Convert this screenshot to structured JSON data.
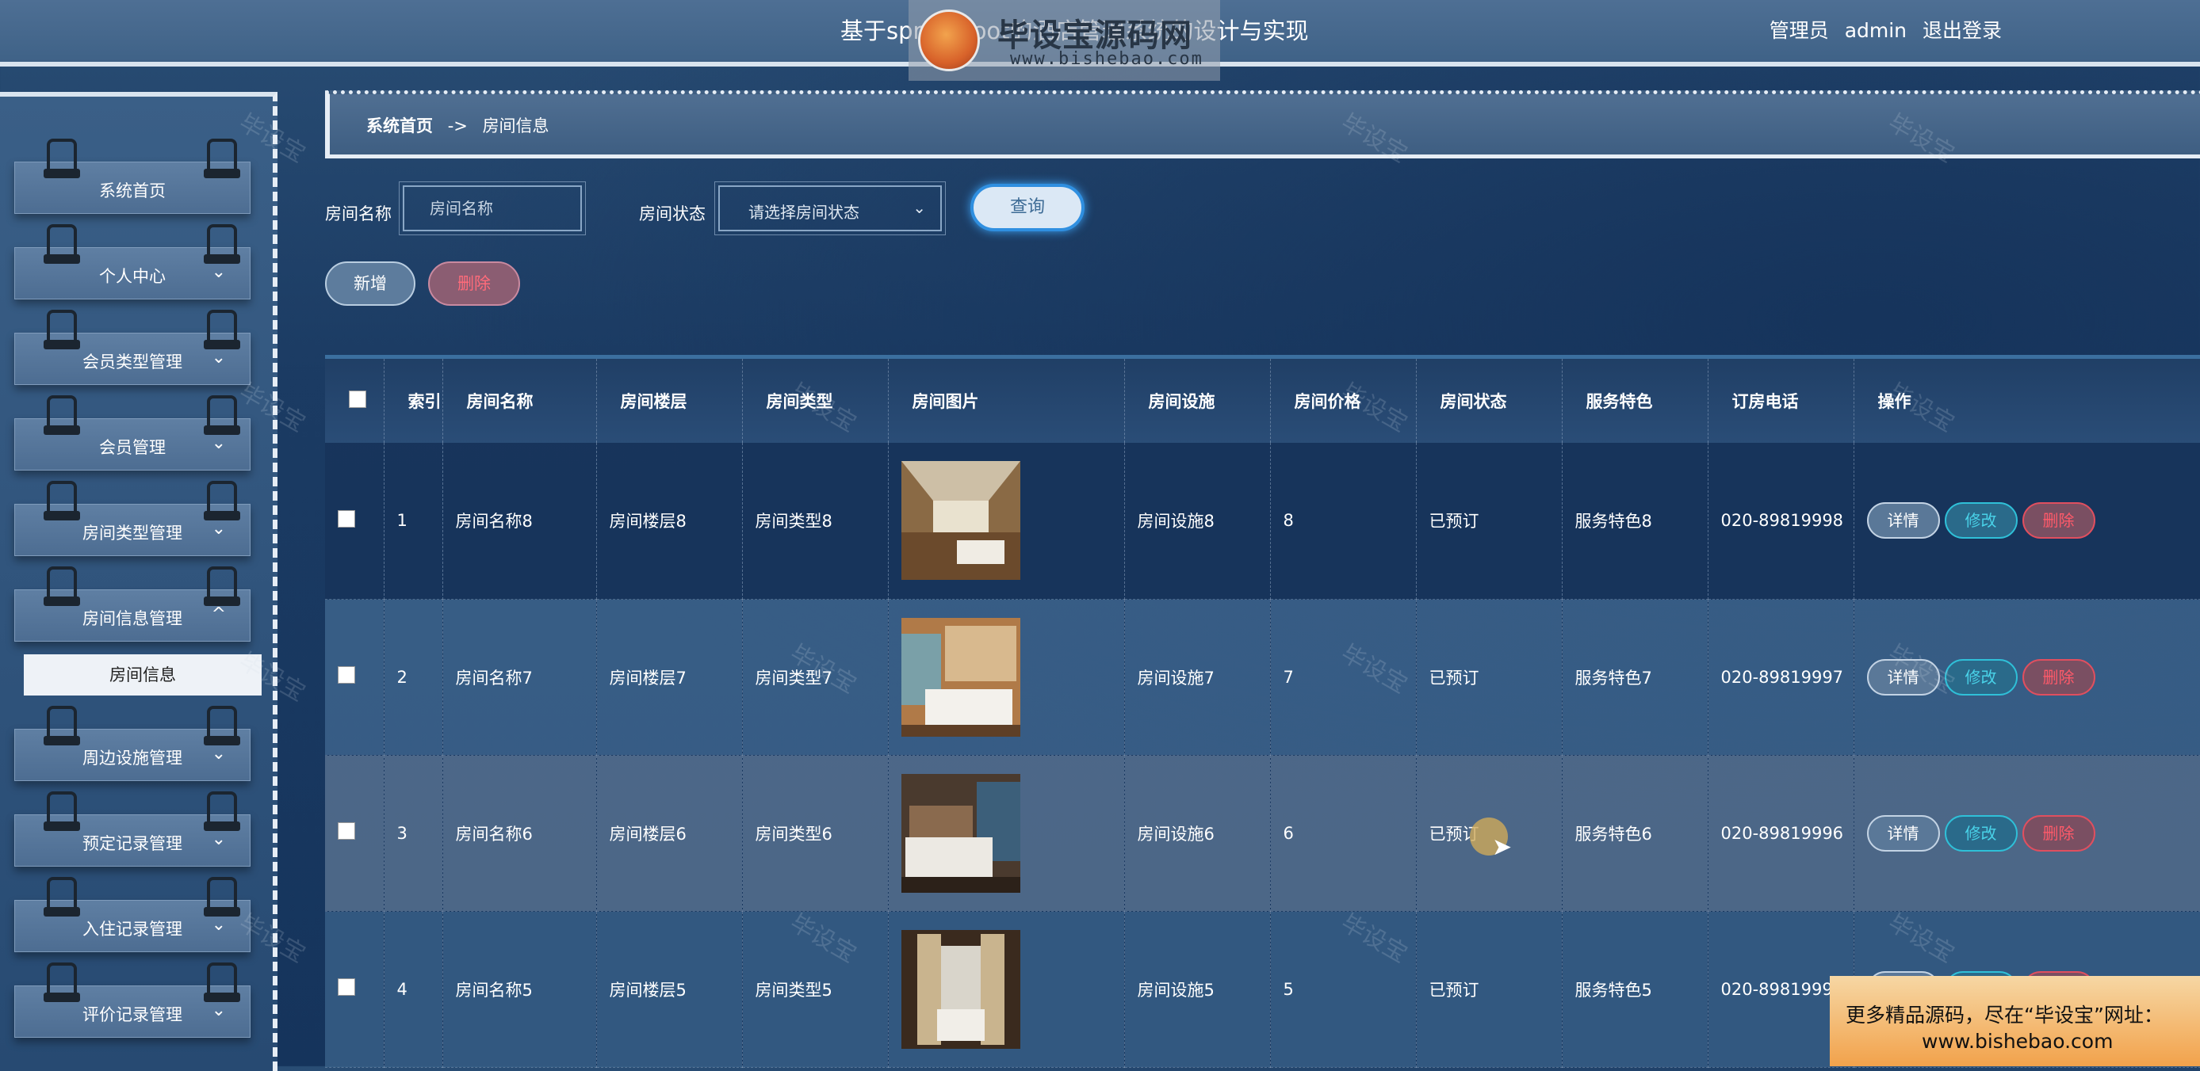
{
  "header": {
    "title": "基于springboot的酒店管理系统的设计与实现",
    "user_role": "管理员",
    "user_name": "admin",
    "logout": "退出登录"
  },
  "watermark_logo": {
    "text": "毕设宝源码网",
    "url_text": "www.bishebao.com"
  },
  "sidebar": {
    "items": [
      {
        "label": "系统首页",
        "expandable": false
      },
      {
        "label": "个人中心",
        "expandable": true
      },
      {
        "label": "会员类型管理",
        "expandable": true
      },
      {
        "label": "会员管理",
        "expandable": true
      },
      {
        "label": "房间类型管理",
        "expandable": true
      },
      {
        "label": "房间信息管理",
        "expandable": true,
        "expanded": true
      },
      {
        "label": "周边设施管理",
        "expandable": true
      },
      {
        "label": "预定记录管理",
        "expandable": true
      },
      {
        "label": "入住记录管理",
        "expandable": true
      },
      {
        "label": "评价记录管理",
        "expandable": true
      }
    ],
    "submenu": {
      "label": "房间信息"
    },
    "chevron_down": "⌄",
    "chevron_up": "^"
  },
  "breadcrumb": {
    "home": "系统首页",
    "separator": "->",
    "current": "房间信息"
  },
  "search": {
    "name_label": "房间名称",
    "name_placeholder": "房间名称",
    "status_label": "房间状态",
    "status_placeholder": "请选择房间状态",
    "query_label": "查询"
  },
  "actions": {
    "add_label": "新增",
    "delete_label": "删除"
  },
  "table": {
    "columns": [
      "",
      "索引",
      "房间名称",
      "房间楼层",
      "房间类型",
      "房间图片",
      "房间设施",
      "房间价格",
      "房间状态",
      "服务特色",
      "订房电话",
      "操作"
    ],
    "rows": [
      {
        "index": "1",
        "name": "房间名称8",
        "floor": "房间楼层8",
        "type": "房间类型8",
        "facility": "房间设施8",
        "price": "8",
        "status": "已预订",
        "feature": "服务特色8",
        "phone": "020-89819998"
      },
      {
        "index": "2",
        "name": "房间名称7",
        "floor": "房间楼层7",
        "type": "房间类型7",
        "facility": "房间设施7",
        "price": "7",
        "status": "已预订",
        "feature": "服务特色7",
        "phone": "020-89819997"
      },
      {
        "index": "3",
        "name": "房间名称6",
        "floor": "房间楼层6",
        "type": "房间类型6",
        "facility": "房间设施6",
        "price": "6",
        "status": "已预订",
        "feature": "服务特色6",
        "phone": "020-89819996"
      },
      {
        "index": "4",
        "name": "房间名称5",
        "floor": "房间楼层5",
        "type": "房间类型5",
        "facility": "房间设施5",
        "price": "5",
        "status": "已预订",
        "feature": "服务特色5",
        "phone": "020-89819995"
      }
    ],
    "row_actions": {
      "detail": "详情",
      "edit": "修改",
      "remove": "删除"
    }
  },
  "promo": {
    "line1": "更多精品源码，尽在“毕设宝”网址：",
    "line2": "www.bishebao.com"
  },
  "watermark_text": "毕设宝",
  "colors": {
    "header_bg": "#4e6f94",
    "query_border": "#2f8fe0",
    "edit_accent": "#2fc0d8",
    "delete_accent": "#e04f5f",
    "promo_bg": "#f2a24b"
  }
}
